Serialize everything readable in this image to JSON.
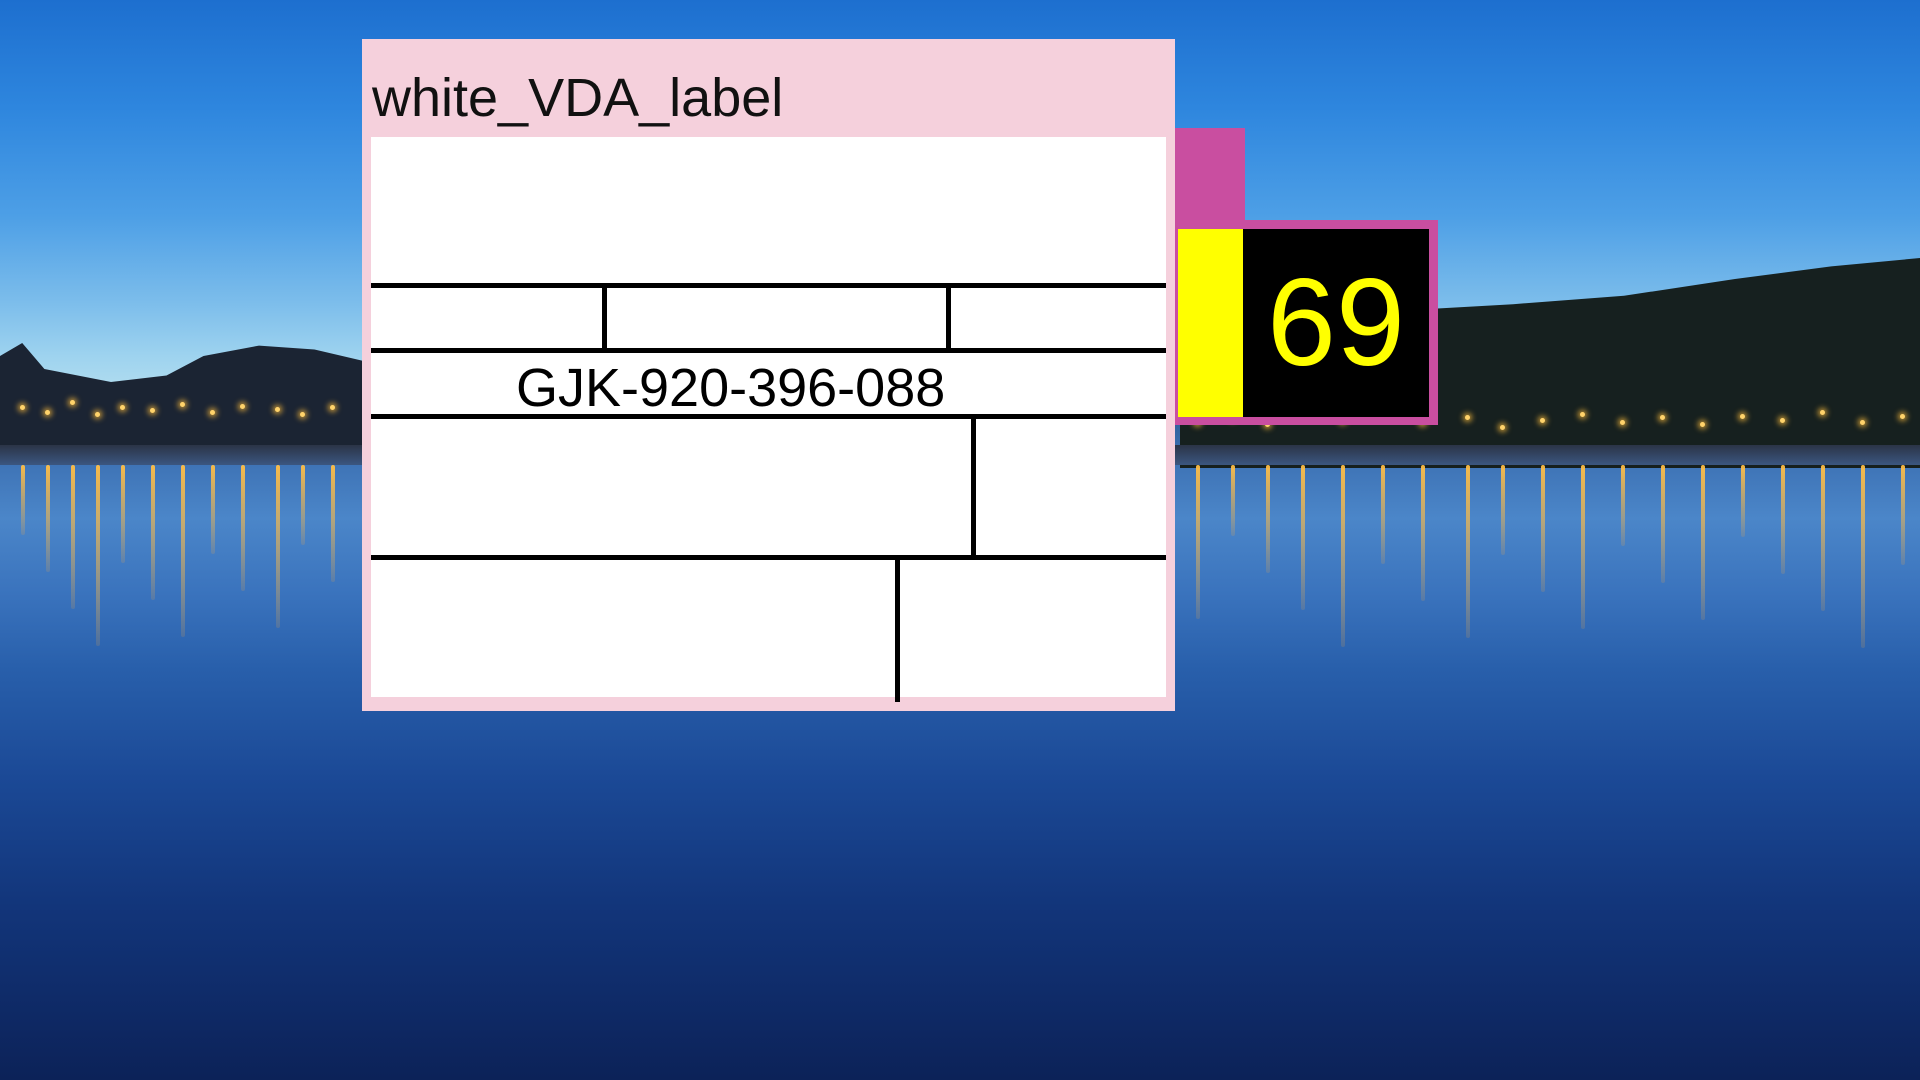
{
  "desktop": {
    "wallpaper": "night-lake-harbor-lights"
  },
  "label_window": {
    "title": "white_VDA_label",
    "part_number": "GJK-920-396-088",
    "background_color": "#f5d0dc"
  },
  "counter_widget": {
    "value": "69",
    "frame_color": "#c94ea0",
    "indicator_color": "#ffff00",
    "value_color": "#ffff00"
  }
}
